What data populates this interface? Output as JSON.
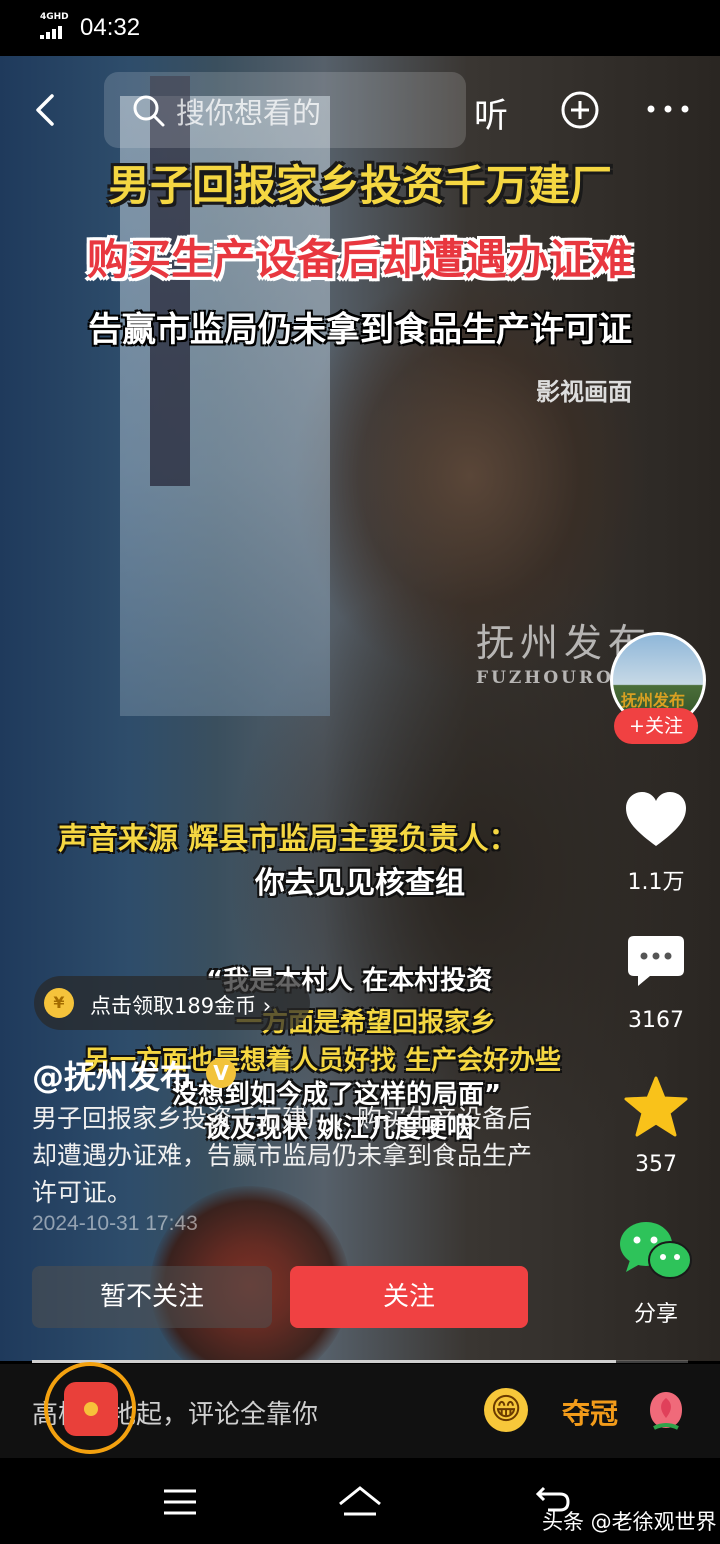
{
  "status_bar": {
    "network": "4GHD",
    "time": "04:32"
  },
  "top_bar": {
    "search_placeholder": "搜你想看的",
    "listen_label": "听"
  },
  "video": {
    "headline_1": "男子回报家乡投资千万建厂",
    "headline_2": "购买生产设备后却遭遇办证难",
    "headline_3": "告赢市监局仍未拿到食品生产许可证",
    "note": "影视画面",
    "watermark": "抚州发布",
    "watermark_sub": "FUZHOURO",
    "sound_source": "声音来源 辉县市监局主要负责人：",
    "subtitle": "你去见见核查组",
    "quote_lines": [
      "“我是本村人 在本村投资",
      "一方面是希望回报家乡",
      "另一方面也是想着人员好找 生产会好办些",
      "没想到如今成了这样的局面”",
      "谈及现状 姚江几度哽咽"
    ]
  },
  "sidebar": {
    "avatar_label": "抚州发布",
    "follow_pill": "+关注",
    "likes": "1.1万",
    "comments": "3167",
    "favorites": "357",
    "share": "分享"
  },
  "coin_banner": {
    "icon": "¥",
    "text": "点击领取189金币 ›"
  },
  "post": {
    "author": "@抚州发布",
    "verified": "V",
    "description": "男子回报家乡投资千万建厂，购买生产设备后却遭遇办证难，告赢市监局仍未拿到食品生产许可证。",
    "date": "2024-10-31 17:43"
  },
  "actions": {
    "not_follow": "暂不关注",
    "follow": "关注"
  },
  "progress": {
    "fraction": 0.89
  },
  "comment_bar": {
    "placeholder": "高楼平地起，评论全靠你",
    "emoji": "😁",
    "crown_label": "夺冠"
  },
  "credit": "头条 @老徐观世界",
  "colors": {
    "accent_red": "#f04142",
    "caption_yellow": "#f5d742"
  }
}
